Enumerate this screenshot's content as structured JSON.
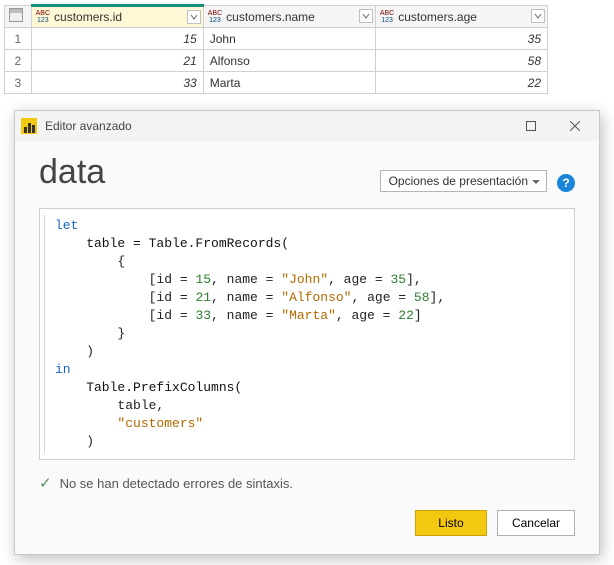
{
  "table": {
    "columns": [
      {
        "name": "customers.id",
        "type_top": "ABC",
        "type_bot": "123",
        "selected": true
      },
      {
        "name": "customers.name",
        "type_top": "ABC",
        "type_bot": "123",
        "selected": false
      },
      {
        "name": "customers.age",
        "type_top": "ABC",
        "type_bot": "123",
        "selected": false
      }
    ],
    "rows": [
      {
        "n": "1",
        "id": "15",
        "name": "John",
        "age": "35"
      },
      {
        "n": "2",
        "id": "21",
        "name": "Alfonso",
        "age": "58"
      },
      {
        "n": "3",
        "id": "33",
        "name": "Marta",
        "age": "22"
      }
    ]
  },
  "dialog": {
    "window_title": "Editor avanzado",
    "title": "data",
    "display_options_label": "Opciones de presentación",
    "status_text": "No se han detectado errores de sintaxis.",
    "done_label": "Listo",
    "cancel_label": "Cancelar",
    "code": {
      "kw_let": "let",
      "kw_in": "in",
      "assign": "    table = Table.FromRecords(",
      "open_brace": "        {",
      "rec1_a": "            [id = ",
      "rec1_id": "15",
      "rec1_b": ", name = ",
      "rec1_name": "\"John\"",
      "rec1_c": ", age = ",
      "rec1_age": "35",
      "rec1_d": "],",
      "rec2_a": "            [id = ",
      "rec2_id": "21",
      "rec2_b": ", name = ",
      "rec2_name": "\"Alfonso\"",
      "rec2_c": ", age = ",
      "rec2_age": "58",
      "rec2_d": "],",
      "rec3_a": "            [id = ",
      "rec3_id": "33",
      "rec3_b": ", name = ",
      "rec3_name": "\"Marta\"",
      "rec3_c": ", age = ",
      "rec3_age": "22",
      "rec3_d": "]",
      "close_brace": "        }",
      "close_paren1": "    )",
      "prefix_call": "    Table.PrefixColumns(",
      "arg_table": "        table,",
      "arg_prefix_indent": "        ",
      "arg_prefix": "\"customers\"",
      "close_paren2": "    )"
    }
  }
}
